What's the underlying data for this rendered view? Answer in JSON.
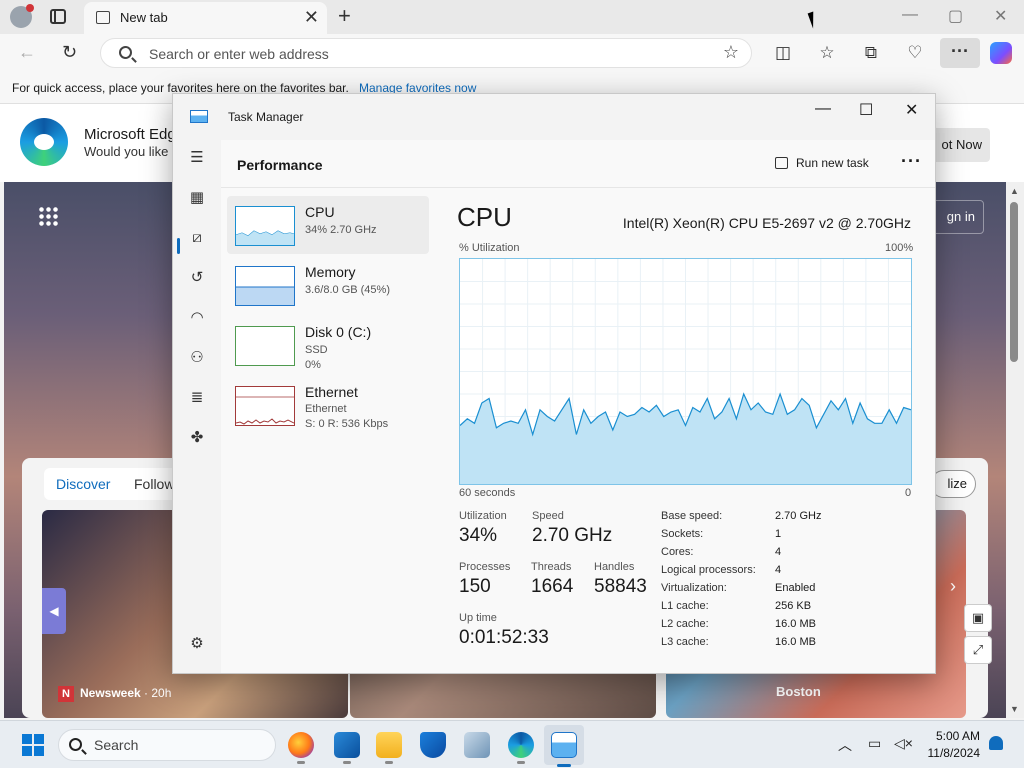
{
  "browser": {
    "tab_title": "New tab",
    "tab_close": "✕",
    "new_tab": "+",
    "address_placeholder": "Search or enter web address",
    "window_controls": {
      "minimize": "—",
      "maximize": "▢",
      "close": "✕"
    },
    "back": "←",
    "refresh": "↻",
    "more": "···"
  },
  "favorites_bar": {
    "text": "For quick access, place your favorites here on the favorites bar.",
    "link": "Manage favorites now"
  },
  "promo": {
    "title": "Microsoft Edg",
    "subtitle": "Would you like t",
    "button": "ot Now"
  },
  "newtab": {
    "signin": "gn in",
    "feed_tabs": [
      "Discover",
      "Follow"
    ],
    "personalize": "lize",
    "news_source": "Newsweek",
    "news_age": "· 20h",
    "news_source_logo": "N",
    "map_label": "Boston"
  },
  "task_manager": {
    "title": "Task Manager",
    "window_controls": {
      "minimize": "—",
      "maximize": "☐",
      "close": "✕"
    },
    "page_title": "Performance",
    "run_new_task": "Run new task",
    "more": "···",
    "perf_items": [
      {
        "name": "CPU",
        "sub1": "34%  2.70 GHz",
        "sub2": ""
      },
      {
        "name": "Memory",
        "sub1": "3.6/8.0 GB (45%)",
        "sub2": ""
      },
      {
        "name": "Disk 0 (C:)",
        "sub1": "SSD",
        "sub2": "0%"
      },
      {
        "name": "Ethernet",
        "sub1": "Ethernet",
        "sub2": "S: 0  R: 536 Kbps"
      }
    ],
    "cpu": {
      "heading": "CPU",
      "model": "Intel(R) Xeon(R) CPU E5-2697 v2 @ 2.70GHz",
      "util_label": "% Utilization",
      "max_label": "100%",
      "time_label": "60 seconds",
      "min_label": "0",
      "stats": {
        "utilization_label": "Utilization",
        "utilization": "34%",
        "speed_label": "Speed",
        "speed": "2.70 GHz",
        "processes_label": "Processes",
        "processes": "150",
        "threads_label": "Threads",
        "threads": "1664",
        "handles_label": "Handles",
        "handles": "58843",
        "uptime_label": "Up time",
        "uptime": "0:01:52:33"
      },
      "specs": [
        {
          "label": "Base speed:",
          "value": "2.70 GHz"
        },
        {
          "label": "Sockets:",
          "value": "1"
        },
        {
          "label": "Cores:",
          "value": "4"
        },
        {
          "label": "Logical processors:",
          "value": "4"
        },
        {
          "label": "Virtualization:",
          "value": "Enabled"
        },
        {
          "label": "L1 cache:",
          "value": "256 KB"
        },
        {
          "label": "L2 cache:",
          "value": "16.0 MB"
        },
        {
          "label": "L3 cache:",
          "value": "16.0 MB"
        }
      ],
      "history_percent": [
        26,
        29,
        27,
        36,
        38,
        25,
        27,
        28,
        27,
        33,
        22,
        33,
        30,
        28,
        33,
        38,
        22,
        33,
        27,
        30,
        32,
        24,
        32,
        30,
        31,
        34,
        32,
        35,
        30,
        32,
        33,
        26,
        34,
        32,
        38,
        29,
        32,
        38,
        29,
        40,
        33,
        36,
        32,
        31,
        40,
        31,
        33,
        38,
        35,
        25,
        31,
        37,
        33,
        38,
        27,
        36,
        29,
        27,
        27,
        33,
        27,
        34,
        33
      ]
    }
  },
  "taskbar": {
    "search": "Search",
    "time": "5:00 AM",
    "date": "11/8/2024"
  },
  "colors": {
    "accent": "#0f6cbd",
    "cpu_graph_line": "#1a8fd1",
    "cpu_graph_fill": "#bfe3f5"
  }
}
